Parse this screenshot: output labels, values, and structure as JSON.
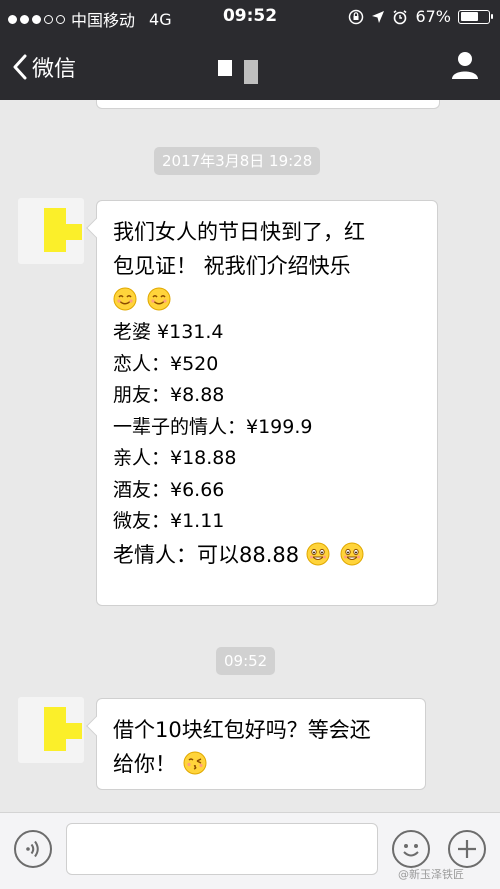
{
  "status_bar": {
    "carrier": "中国移动",
    "network": "4G",
    "time": "09:52",
    "battery_percent": "67%",
    "battery_level": 0.67,
    "signal_bars_filled": 3,
    "signal_bars_total": 5
  },
  "nav": {
    "back_label": "微信"
  },
  "chat": {
    "timestamp_1": "2017年3月8日 19:28",
    "message_1": {
      "lines": [
        "我们女人的节日快到了，红",
        "包见证！  祝我们介绍快乐",
        "",
        "老婆 ¥131.4",
        "恋人：¥520",
        "朋友：¥8.88",
        "一辈子的情人：¥199.9",
        "亲人：¥18.88",
        "酒友：¥6.66",
        "微友：¥1.11",
        "老情人：可以88.88"
      ]
    },
    "timestamp_2": "09:52",
    "message_2": {
      "lines": [
        "借个10块红包好吗？等会还",
        "给你！"
      ]
    }
  },
  "watermark": "@新玉泽铁匠",
  "colors": {
    "header_bg": "#2b2b2f",
    "chat_bg": "#e9e9e9",
    "timestamp_bg": "#d1d1d1",
    "avatar_yellow": "#fbef2a",
    "emoji_yellow": "#ffd43b"
  }
}
